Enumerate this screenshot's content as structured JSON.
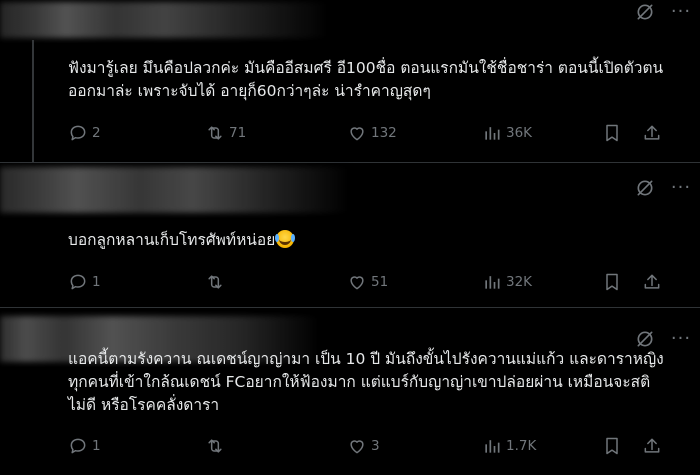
{
  "replies": [
    {
      "text": "ฟังมารู้เลย มึนคือปลวกค่ะ มันคืออีสมศรี อี100ชื่อ ตอนแรกมันใช้ชื่อชาร่า ตอนนี้เปิดตัวตนออกมาล่ะ เพราะจับได้ อายุก็60กว่าๆล่ะ น่ารำคาญสุดๆ",
      "stats": {
        "replies": "2",
        "retweets": "71",
        "likes": "132",
        "views": "36K"
      }
    },
    {
      "text": "บอกลูกหลานเก็บโทรศัพท์หน่อย",
      "emoji": "face-with-tears-of-joy",
      "stats": {
        "replies": "1",
        "retweets": "",
        "likes": "51",
        "views": "32K"
      }
    },
    {
      "text": "แอคนี้ตามรังควาน ณเดชน์ญาญ่ามา เป็น 10 ปี มันถึงขั้นไปรังควานแม่แก้ว และดาราหญิงทุกคนที่เข้าใกล้ณเดชน์ FCอยากให้ฟ้องมาก แต่แบร์กับญาญ่าเขาปล่อยผ่าน เหมือนจะสติไม่ดี หรือโรคคลั่งดารา",
      "stats": {
        "replies": "1",
        "retweets": "",
        "likes": "3",
        "views": "1.7K"
      }
    }
  ],
  "icons": {
    "grok": "grok-icon",
    "more": "more-options-icon",
    "reply": "reply-bubble-icon",
    "retweet": "retweet-icon",
    "like": "heart-icon",
    "views": "views-bar-chart-icon",
    "bookmark": "bookmark-icon",
    "share": "share-upload-icon"
  },
  "colors": {
    "background": "#000000",
    "text": "#e7e9ea",
    "muted": "#71767b",
    "divider": "#2f3336"
  }
}
